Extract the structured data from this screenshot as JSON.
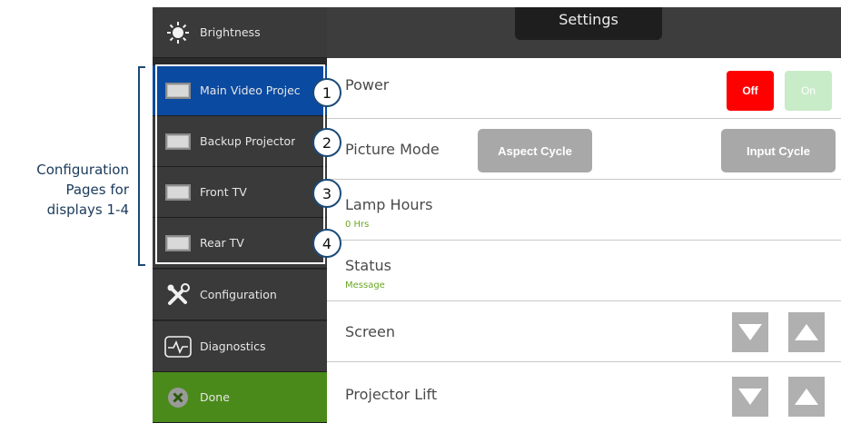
{
  "annotation": {
    "lines": [
      "Configuration",
      "Pages for",
      "displays 1-4"
    ]
  },
  "header": {
    "title": "Settings"
  },
  "sidebar": {
    "items": [
      {
        "label": "Brightness",
        "icon": "sun-icon"
      },
      {
        "label": "Main Video Projec",
        "icon": "display-icon",
        "active": true
      },
      {
        "label": "Backup Projector",
        "icon": "display-icon"
      },
      {
        "label": "Front TV",
        "icon": "display-icon"
      },
      {
        "label": "Rear TV",
        "icon": "display-icon"
      },
      {
        "label": "Configuration",
        "icon": "tools-icon"
      },
      {
        "label": "Diagnostics",
        "icon": "waveform-icon"
      },
      {
        "label": "Done",
        "icon": "close-circle-icon"
      }
    ]
  },
  "callouts": [
    "1",
    "2",
    "3",
    "4"
  ],
  "main": {
    "power": {
      "label": "Power",
      "off_label": "Off",
      "on_label": "On"
    },
    "picture_mode": {
      "label": "Picture Mode",
      "aspect_label": "Aspect Cycle",
      "input_label": "Input Cycle"
    },
    "lamp_hours": {
      "label": "Lamp Hours",
      "value": "0 Hrs"
    },
    "status": {
      "label": "Status",
      "value": "Message"
    },
    "screen": {
      "label": "Screen"
    },
    "projector_lift": {
      "label": "Projector Lift"
    }
  },
  "colors": {
    "active_blue": "#0a4aa0",
    "done_green": "#4a8a1a",
    "off_red": "#ff0000",
    "on_green_light": "#c8ebc8",
    "sub_text_green": "#6aa820"
  }
}
